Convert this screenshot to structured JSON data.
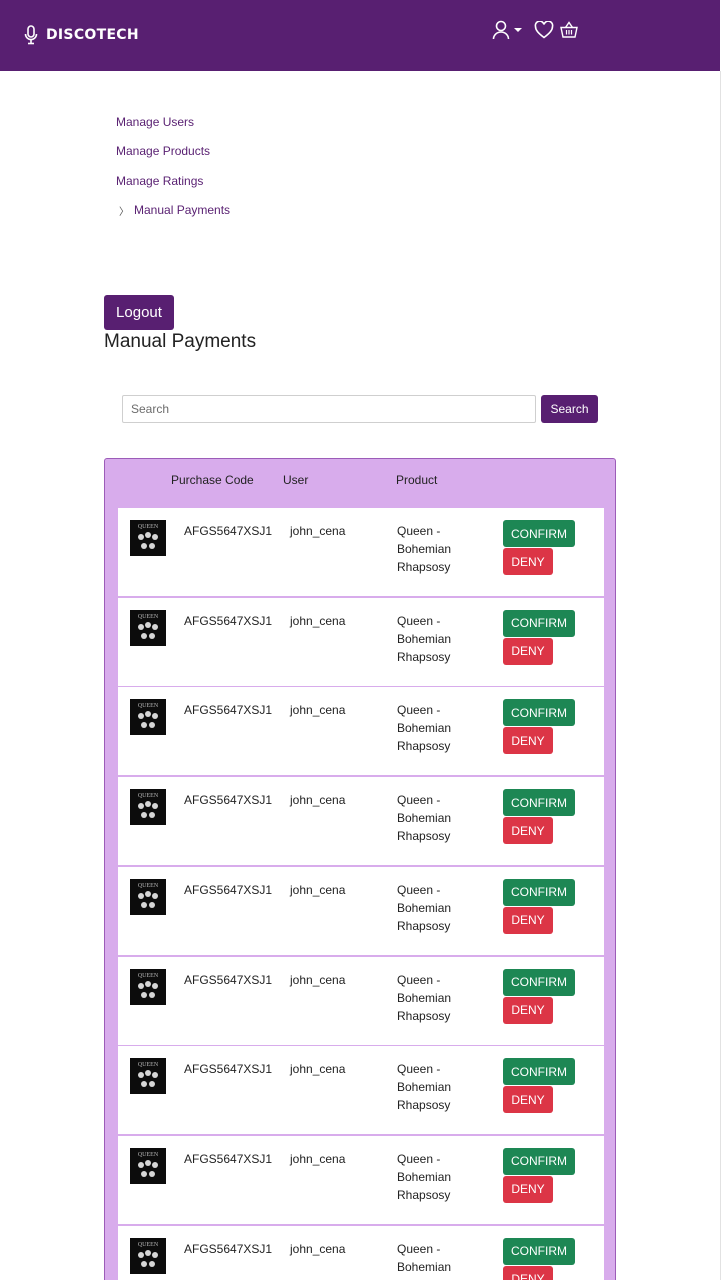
{
  "header": {
    "brand": "DISCOTECH",
    "icons": [
      "microphone-icon",
      "user-icon",
      "chevron-down-icon",
      "heart-icon",
      "basket-icon"
    ],
    "colors": {
      "brand": "#581f71"
    }
  },
  "side_nav": {
    "items": [
      {
        "label": "Manage Users",
        "active": false
      },
      {
        "label": "Manage Products",
        "active": false
      },
      {
        "label": "Manage Ratings",
        "active": false
      },
      {
        "label": "Manual Payments",
        "active": true
      }
    ]
  },
  "logout_label": "Logout",
  "page_title": "Manual Payments",
  "search": {
    "placeholder": "Search",
    "value": "",
    "button_label": "Search"
  },
  "table": {
    "headers": {
      "purchase_code": "Purchase Code",
      "user": "User",
      "product": "Product"
    },
    "rows": [
      {
        "code": "AFGS5647XSJ1",
        "user": "john_cena",
        "product": "Queen - Bohemian Rhapsosy",
        "confirm": "CONFIRM",
        "deny": "DENY"
      },
      {
        "code": "AFGS5647XSJ1",
        "user": "john_cena",
        "product": "Queen - Bohemian Rhapsosy",
        "confirm": "CONFIRM",
        "deny": "DENY"
      },
      {
        "code": "AFGS5647XSJ1",
        "user": "john_cena",
        "product": "Queen - Bohemian Rhapsosy",
        "confirm": "CONFIRM",
        "deny": "DENY"
      },
      {
        "code": "AFGS5647XSJ1",
        "user": "john_cena",
        "product": "Queen - Bohemian Rhapsosy",
        "confirm": "CONFIRM",
        "deny": "DENY"
      },
      {
        "code": "AFGS5647XSJ1",
        "user": "john_cena",
        "product": "Queen - Bohemian Rhapsosy",
        "confirm": "CONFIRM",
        "deny": "DENY"
      },
      {
        "code": "AFGS5647XSJ1",
        "user": "john_cena",
        "product": "Queen - Bohemian Rhapsosy",
        "confirm": "CONFIRM",
        "deny": "DENY"
      },
      {
        "code": "AFGS5647XSJ1",
        "user": "john_cena",
        "product": "Queen - Bohemian Rhapsosy",
        "confirm": "CONFIRM",
        "deny": "DENY"
      },
      {
        "code": "AFGS5647XSJ1",
        "user": "john_cena",
        "product": "Queen - Bohemian Rhapsosy",
        "confirm": "CONFIRM",
        "deny": "DENY"
      },
      {
        "code": "AFGS5647XSJ1",
        "user": "john_cena",
        "product": "Queen - Bohemian Rhapsosy",
        "confirm": "CONFIRM",
        "deny": "DENY"
      }
    ],
    "colors": {
      "panel": "#d8acec",
      "confirm": "#1d8754",
      "deny": "#dc3546"
    }
  }
}
